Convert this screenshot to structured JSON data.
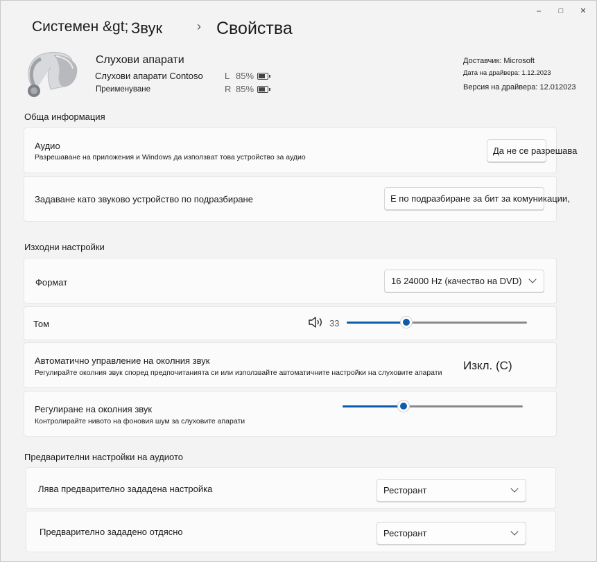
{
  "window": {
    "controls": {
      "minimize": "–",
      "maximize": "□",
      "close": "✕"
    }
  },
  "breadcrumb": {
    "root": "Системен &gt;",
    "parent": "Звук",
    "separator": "›",
    "current": "Свойства"
  },
  "device": {
    "name": "Слухови апарати",
    "model": "Слухови апарати Contoso",
    "rename_link": "Преименуване",
    "battery": {
      "left": {
        "side": "L",
        "percent": "85%"
      },
      "right": {
        "side": "R",
        "percent": "85%"
      }
    },
    "driver": {
      "vendor": "Доставчик: Microsoft",
      "date": "Дата на драйвера: 1.12.2023",
      "version": "Версия на драйвера: 12.012023"
    }
  },
  "general": {
    "title": "Обща информация",
    "audio": {
      "title": "Аудио",
      "subtitle": "Разрешаване на приложения и Windows да използват това устройство за аудио",
      "button": "Да не се разрешава"
    },
    "default_device": {
      "title": "Задаване като звуково устройство по подразбиране",
      "button": "Е по подразбиране за бит за комуникации,"
    }
  },
  "output": {
    "title": "Изходни настройки",
    "format": {
      "label": "Формат",
      "value": "16 24000 Hz (качество на DVD)"
    },
    "volume": {
      "label": "Том",
      "value": "33",
      "level": 0.33
    },
    "ambient_auto": {
      "title": "Автоматично управление на околния звук",
      "subtitle": "Регулирайте околния звук според предпочитанията си или използвайте автоматичните настройки на слуховите апарати",
      "state": "Изкл. (С)"
    },
    "ambient_level": {
      "title": "Регулиране на околния звук",
      "subtitle": "Контролирайте нивото на фоновия шум за слуховите апарати",
      "level": 0.34
    }
  },
  "presets": {
    "title": "Предварителни настройки на аудиото",
    "left": {
      "label": "Лява предварително зададена настройка",
      "value": "Ресторант"
    },
    "right": {
      "label": "Предварително зададено отдясно",
      "value": "Ресторант"
    }
  },
  "colors": {
    "accent": "#0b5cad",
    "background": "#f3f3f3",
    "card": "#fbfbfb"
  }
}
